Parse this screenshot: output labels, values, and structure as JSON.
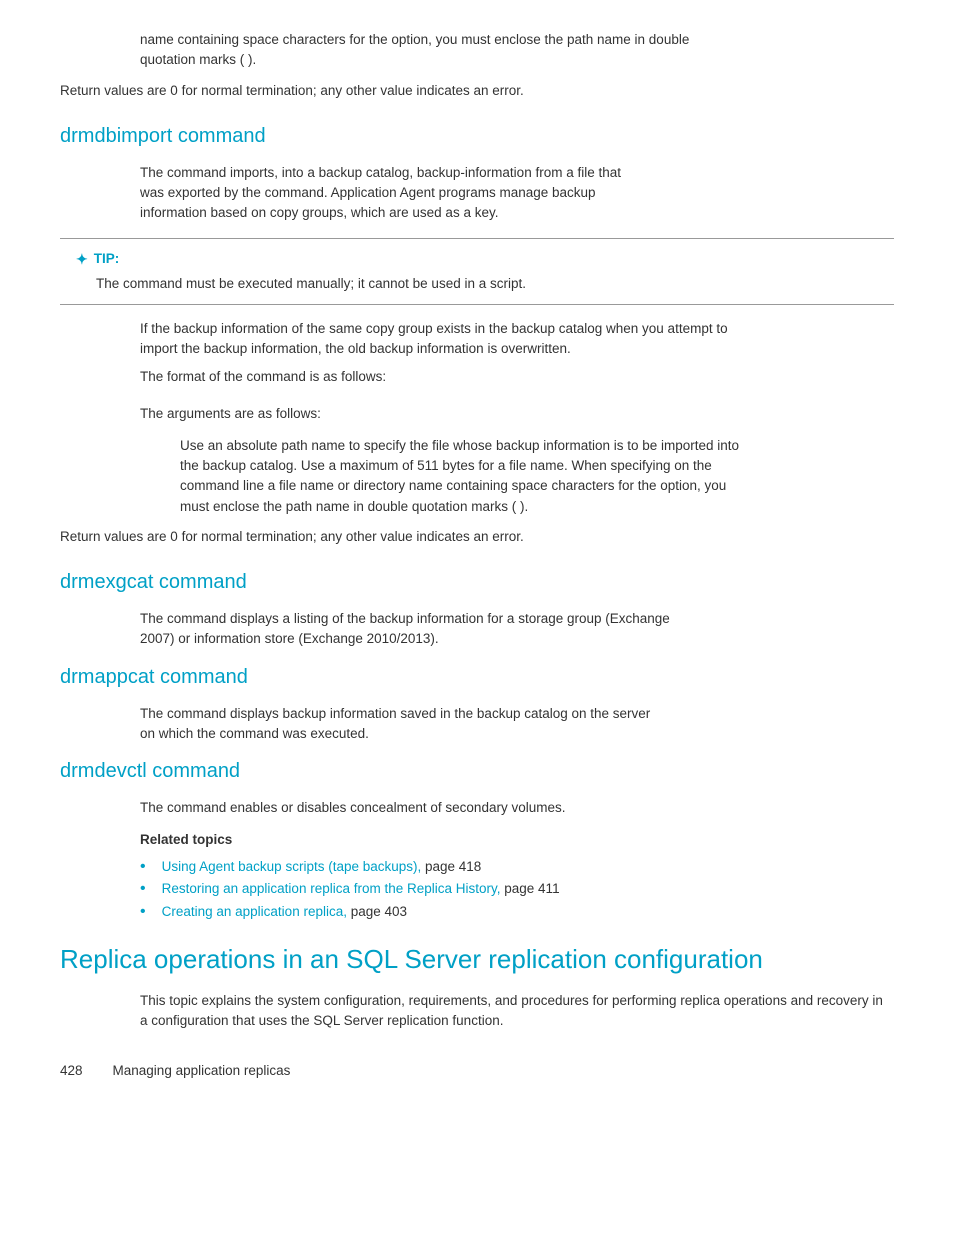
{
  "page": {
    "intro": {
      "line1": "name containing space characters for the      option, you must enclose the path name in double",
      "line2": "quotation marks (  )."
    },
    "return_normal": "Return values are 0 for normal termination; any other value indicates an error.",
    "sections": [
      {
        "id": "drmdbimport",
        "heading": "drmdbimport command",
        "body": [
          "The                   command imports, into a backup catalog, backup-information from a file that",
          "was exported by the                       command. Application Agent programs manage backup",
          "information based on copy groups, which are used as a key."
        ],
        "tip": {
          "label": "TIP:",
          "content": "The                   command must be executed manually; it cannot be used in a script."
        },
        "after_tip": [
          "If the backup information of the same copy group exists in the backup catalog when you attempt to",
          "import the backup information, the old backup information is overwritten.",
          "The format of the command is as follows:",
          "",
          "The arguments are as follows:"
        ],
        "indent_block": [
          "Use an absolute path name to specify the file whose backup information is to be imported into",
          "the backup catalog. Use a maximum of 511 bytes for a file name. When specifying on the",
          "command line a file name or directory name containing space characters for the      option, you",
          "must enclose the path name in double quotation marks (  )."
        ],
        "return": "Return values are 0 for normal termination; any other value indicates an error."
      },
      {
        "id": "drmexgcat",
        "heading": "drmexgcat command",
        "body": [
          "The              command displays a listing of the backup information for a storage group (Exchange",
          "2007) or information store (Exchange 2010/2013)."
        ]
      },
      {
        "id": "drmappcat",
        "heading": "drmappcat command",
        "body": [
          "The               command displays backup information saved in the backup catalog on the server",
          "on which the command was executed."
        ]
      },
      {
        "id": "drmdevctl",
        "heading": "drmdevctl command",
        "body": [
          "The               command enables or disables concealment of secondary volumes."
        ],
        "related_topics": {
          "label": "Related topics",
          "links": [
            {
              "text": "Using Agent backup scripts (tape backups),",
              "suffix": " page 418"
            },
            {
              "text": "Restoring an application replica from the Replica History,",
              "suffix": " page 411"
            },
            {
              "text": "Creating an application replica,",
              "suffix": " page 403"
            }
          ]
        }
      }
    ],
    "main_section": {
      "heading": "Replica operations in an SQL Server replication configuration",
      "body": "This topic explains the system configuration, requirements, and procedures for performing replica operations and recovery in a configuration that uses the SQL Server replication function."
    },
    "footer": {
      "page_number": "428",
      "text": "Managing application replicas"
    }
  }
}
